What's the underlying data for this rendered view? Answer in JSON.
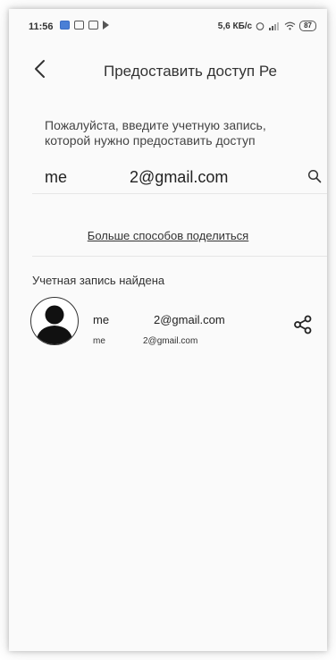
{
  "status_bar": {
    "time": "11:56",
    "net_speed": "5,6 КБ/с",
    "battery": "87"
  },
  "header": {
    "title": "Предоставить доступ Ре"
  },
  "instruction": "Пожалуйста, введите учетную запись, которой нужно предоставить доступ",
  "search": {
    "value_prefix": "me",
    "value_suffix": "2@gmail.com",
    "value": "me              2@gmail.com"
  },
  "more_ways_link": "Больше способов поделиться",
  "found_heading": "Учетная запись найдена",
  "account": {
    "name_prefix": "me",
    "name_suffix": "2@gmail.com",
    "email_prefix": "me",
    "email_suffix": "2@gmail.com"
  },
  "icons": {
    "back": "chevron-left-icon",
    "search": "search-icon",
    "share": "share-icon",
    "avatar": "user-avatar-icon"
  },
  "colors": {
    "background": "#fafafa",
    "text": "#222222",
    "divider": "#e6e6e6",
    "status_blue": "#4a7fd6"
  }
}
